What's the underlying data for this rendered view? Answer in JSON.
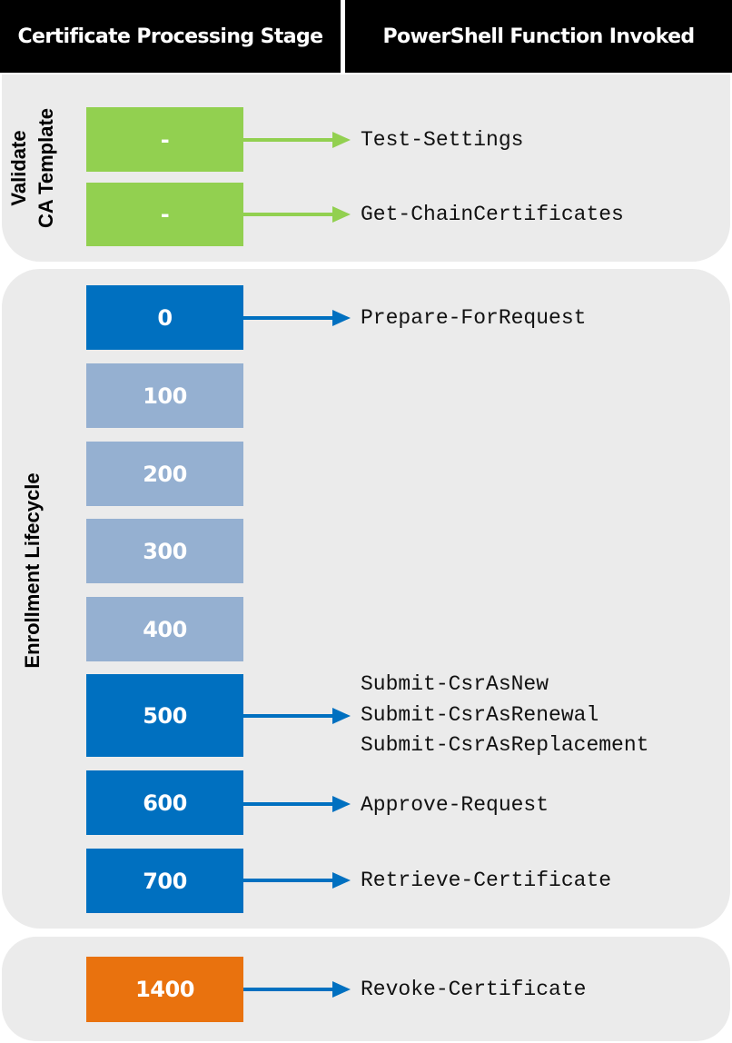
{
  "header": {
    "left": "Certificate Processing Stage",
    "right": "PowerShell Function Invoked"
  },
  "colors": {
    "validate": "#92d050",
    "active": "#0070c0",
    "inactive": "#95b0d1",
    "revoke": "#e9720e",
    "panel": "#ebebeb"
  },
  "sections": [
    {
      "label_lines": [
        "Validate",
        "CA Template"
      ],
      "stages": [
        {
          "code": "-",
          "functions": [
            "Test-Settings"
          ]
        },
        {
          "code": "-",
          "functions": [
            "Get-ChainCertificates"
          ]
        }
      ]
    },
    {
      "label_lines": [
        "Enrollment Lifecycle"
      ],
      "stages": [
        {
          "code": "0",
          "functions": [
            "Prepare-ForRequest"
          ]
        },
        {
          "code": "100",
          "functions": []
        },
        {
          "code": "200",
          "functions": []
        },
        {
          "code": "300",
          "functions": []
        },
        {
          "code": "400",
          "functions": []
        },
        {
          "code": "500",
          "functions": [
            "Submit-CsrAsNew",
            "Submit-CsrAsRenewal",
            "Submit-CsrAsReplacement"
          ]
        },
        {
          "code": "600",
          "functions": [
            "Approve-Request"
          ]
        },
        {
          "code": "700",
          "functions": [
            "Retrieve-Certificate"
          ]
        }
      ]
    },
    {
      "label_lines": [],
      "stages": [
        {
          "code": "1400",
          "functions": [
            "Revoke-Certificate"
          ]
        }
      ]
    }
  ]
}
